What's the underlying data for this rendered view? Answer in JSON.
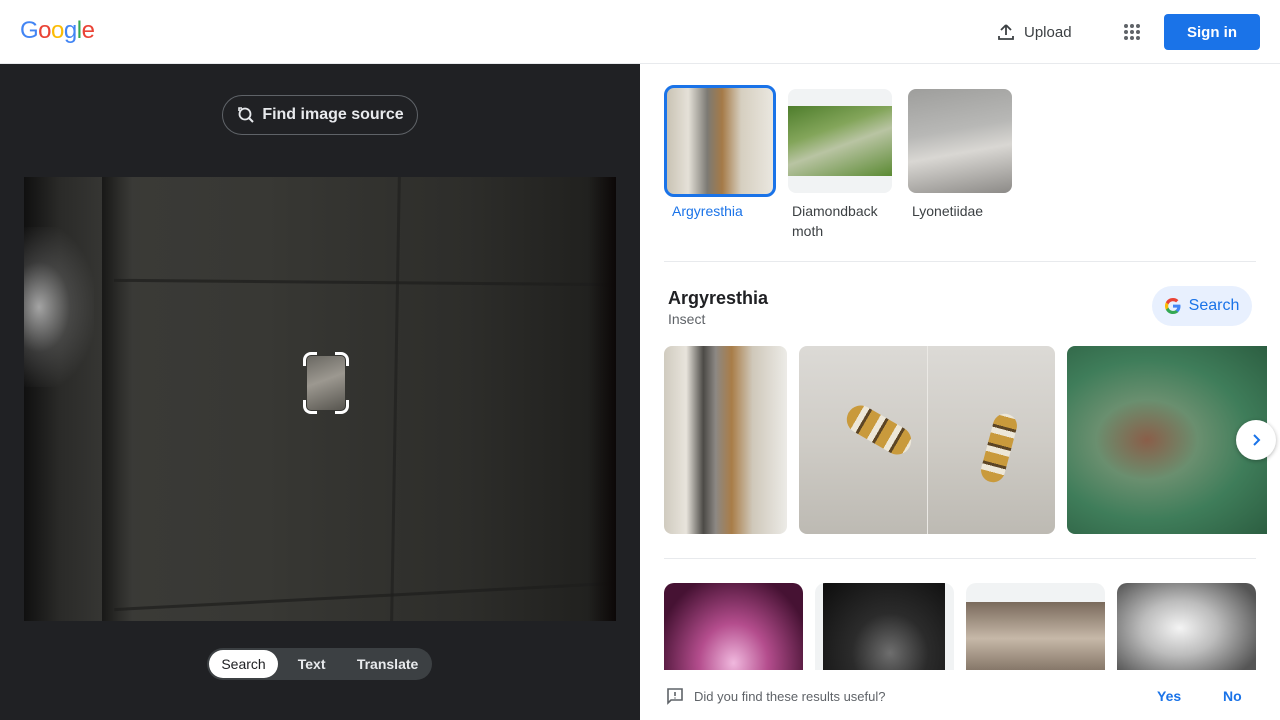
{
  "header": {
    "logo": {
      "letters": [
        "G",
        "o",
        "o",
        "g",
        "l",
        "e"
      ],
      "colors": [
        "#4285f4",
        "#ea4335",
        "#fbbc05",
        "#4285f4",
        "#34a853",
        "#ea4335"
      ]
    },
    "upload_label": "Upload",
    "signin_label": "Sign in",
    "icons": {
      "upload": "upload-icon",
      "apps": "apps-grid-icon"
    }
  },
  "left": {
    "find_source_label": "Find image source",
    "modes": [
      {
        "label": "Search",
        "active": true
      },
      {
        "label": "Text",
        "active": false
      },
      {
        "label": "Translate",
        "active": false
      }
    ]
  },
  "chips": [
    {
      "label": "Argyresthia",
      "selected": true
    },
    {
      "label": "Diamondback moth",
      "selected": false
    },
    {
      "label": "Lyonetiidae",
      "selected": false
    }
  ],
  "knowledge": {
    "title": "Argyresthia",
    "subtitle": "Insect",
    "search_label": "Search"
  },
  "feedback": {
    "question": "Did you find these results useful?",
    "yes": "Yes",
    "no": "No"
  },
  "colors": {
    "accent": "#1a73e8",
    "dark_panel": "#202124",
    "pill_bg": "#e8f0fe"
  }
}
